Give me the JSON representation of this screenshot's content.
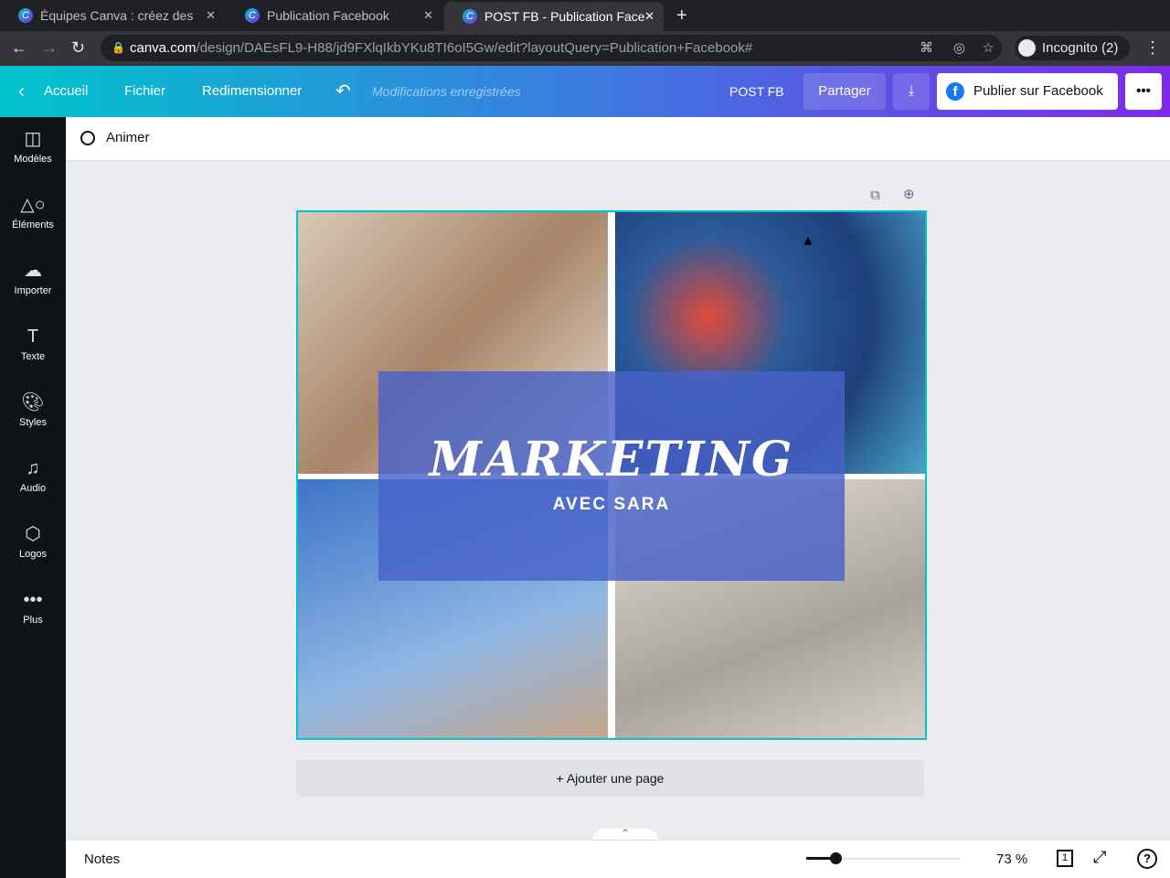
{
  "browser": {
    "tabs": [
      {
        "title": "Équipes Canva : créez des"
      },
      {
        "title": "Publication Facebook"
      },
      {
        "title": "POST FB - Publication Face"
      }
    ],
    "url_domain": "canva.com",
    "url_path": "/design/DAEsFL9-H88/jd9FXlqIkbYKu8TI6oI5Gw/edit?layoutQuery=Publication+Facebook#",
    "profile": "Incognito (2)"
  },
  "header": {
    "home": "Accueil",
    "file": "Fichier",
    "resize": "Redimensionner",
    "save_status": "Modifications enregistrées",
    "design_name": "POST FB",
    "share": "Partager",
    "publish": "Publier sur Facebook"
  },
  "sidebar": {
    "items": [
      {
        "label": "Modèles"
      },
      {
        "label": "Éléments"
      },
      {
        "label": "Importer"
      },
      {
        "label": "Texte"
      },
      {
        "label": "Styles"
      },
      {
        "label": "Audio"
      },
      {
        "label": "Logos"
      },
      {
        "label": "Plus"
      }
    ]
  },
  "toolbar": {
    "animate": "Animer"
  },
  "design": {
    "title": "MARKETING",
    "subtitle": "AVEC SARA"
  },
  "add_page": "+ Ajouter une page",
  "footer": {
    "notes": "Notes",
    "zoom_percent": 73,
    "zoom_label": "73 %",
    "page_count": "1"
  },
  "colors": {
    "accent": "#00c4cc",
    "purple": "#7d2ae8",
    "banner": "#4862c8"
  }
}
